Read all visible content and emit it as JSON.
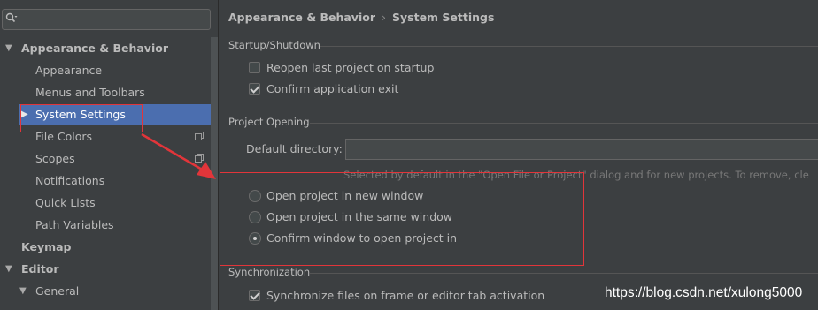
{
  "search": {
    "placeholder": ""
  },
  "sidebar": {
    "items": [
      {
        "label": "Appearance & Behavior",
        "expanded": true
      },
      {
        "label": "Appearance"
      },
      {
        "label": "Menus and Toolbars"
      },
      {
        "label": "System Settings",
        "selected": true,
        "collapsed": true
      },
      {
        "label": "File Colors",
        "icon": "copy-icon"
      },
      {
        "label": "Scopes",
        "icon": "copy-icon"
      },
      {
        "label": "Notifications"
      },
      {
        "label": "Quick Lists"
      },
      {
        "label": "Path Variables"
      },
      {
        "label": "Keymap"
      },
      {
        "label": "Editor",
        "expanded": true
      },
      {
        "label": "General",
        "expanded": true
      }
    ]
  },
  "breadcrumb": {
    "parent": "Appearance & Behavior",
    "separator": "›",
    "current": "System Settings"
  },
  "startup": {
    "title": "Startup/Shutdown",
    "reopen_label": "Reopen last project on startup",
    "reopen_checked": false,
    "confirm_exit_label": "Confirm application exit",
    "confirm_exit_checked": true
  },
  "project_opening": {
    "title": "Project Opening",
    "default_dir_label": "Default directory:",
    "default_dir_value": "",
    "hint": "Selected by default in the \"Open File or Project\" dialog and for new projects. To remove, cle",
    "options": [
      {
        "label": "Open project in new window",
        "selected": false
      },
      {
        "label": "Open project in the same window",
        "selected": false
      },
      {
        "label": "Confirm window to open project in",
        "selected": true
      }
    ]
  },
  "synchronization": {
    "title": "Synchronization",
    "sync_label": "Synchronize files on frame or editor tab activation",
    "sync_checked": true
  },
  "watermark": "https://blog.csdn.net/xulong5000",
  "colors": {
    "background": "#3c3f41",
    "selection": "#4b6eaf",
    "annotation": "#e2353a"
  }
}
